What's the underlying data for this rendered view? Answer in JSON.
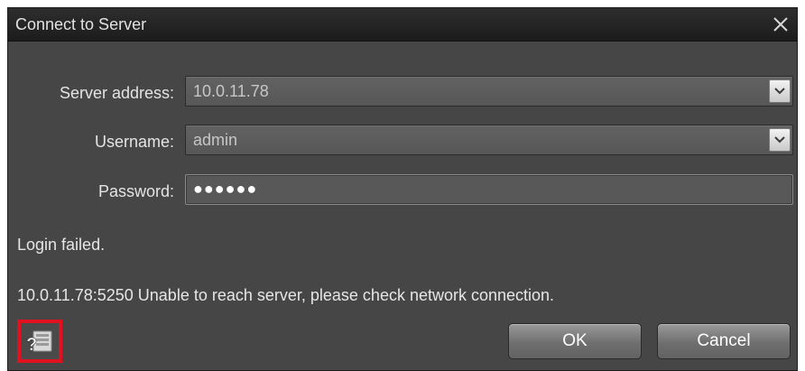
{
  "window": {
    "title": "Connect to Server",
    "close_icon": "close-icon"
  },
  "form": {
    "server_address": {
      "label": "Server address:",
      "value": "10.0.11.78"
    },
    "username": {
      "label": "Username:",
      "value": "admin"
    },
    "password": {
      "label": "Password:",
      "masked_value": "●●●●●●"
    }
  },
  "status": {
    "login_message": "Login failed.",
    "error_message": "10.0.11.78:5250 Unable to reach server, please check network connection."
  },
  "footer": {
    "help_icon": "help-network-icon",
    "ok_label": "OK",
    "cancel_label": "Cancel"
  },
  "colors": {
    "dialog_bg": "#464646",
    "titlebar_bg": "#1c1c1c",
    "highlight_border": "#e1121f"
  }
}
